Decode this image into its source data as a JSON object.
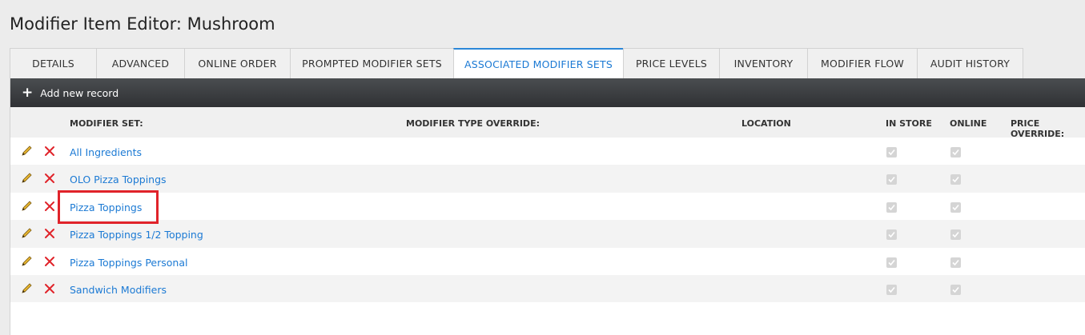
{
  "page": {
    "title": "Modifier Item Editor: Mushroom"
  },
  "tabs": [
    {
      "label": "DETAILS",
      "active": false
    },
    {
      "label": "ADVANCED",
      "active": false
    },
    {
      "label": "ONLINE ORDER",
      "active": false
    },
    {
      "label": "PROMPTED MODIFIER SETS",
      "active": false
    },
    {
      "label": "ASSOCIATED MODIFIER SETS",
      "active": true
    },
    {
      "label": "PRICE LEVELS",
      "active": false
    },
    {
      "label": "INVENTORY",
      "active": false
    },
    {
      "label": "MODIFIER FLOW",
      "active": false
    },
    {
      "label": "AUDIT HISTORY",
      "active": false
    }
  ],
  "toolbar": {
    "add_label": "Add new record"
  },
  "table": {
    "columns": {
      "modifier_set": "MODIFIER SET:",
      "type_override": "MODIFIER TYPE OVERRIDE:",
      "location": "LOCATION",
      "in_store": "IN STORE",
      "online": "ONLINE",
      "price_override": "PRICE OVERRIDE:"
    },
    "rows": [
      {
        "name": "All Ingredients",
        "in_store": true,
        "online": true
      },
      {
        "name": "OLO Pizza Toppings",
        "in_store": true,
        "online": true
      },
      {
        "name": "Pizza Toppings",
        "in_store": true,
        "online": true,
        "highlighted": true
      },
      {
        "name": "Pizza Toppings 1/2 Topping",
        "in_store": true,
        "online": true
      },
      {
        "name": "Pizza Toppings Personal",
        "in_store": true,
        "online": true
      },
      {
        "name": "Sandwich Modifiers",
        "in_store": true,
        "online": true
      }
    ]
  },
  "colors": {
    "accent": "#1c7ad4",
    "highlight": "#e0232a",
    "delete": "#e0232a",
    "toolbar": "#3a3c3f"
  }
}
